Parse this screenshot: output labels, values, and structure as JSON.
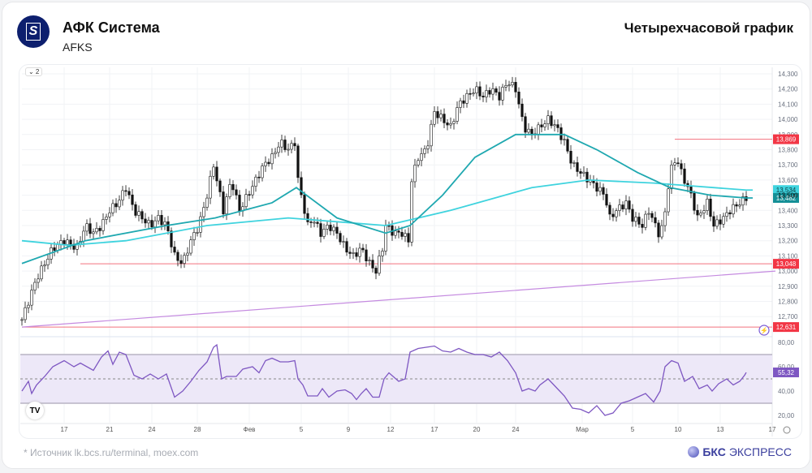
{
  "header": {
    "company": "АФК Система",
    "ticker": "AFKS",
    "chart_title": "Четырехчасовой график"
  },
  "controls": {
    "collapse_label": "⌄ 2",
    "tv_logo": "TV"
  },
  "footer": {
    "source": "*  Источник lk.bcs.ru/terminal, moex.com",
    "brand_prefix": "БКС",
    "brand_suffix": "ЭКСПРЕСС"
  },
  "chart_data": [
    {
      "type": "candlestick",
      "title": "AFKS 4H",
      "x_unit": "4h bar index",
      "ylim": [
        12600,
        14300
      ],
      "y_ticks": [
        "14,300",
        "14,200",
        "14,100",
        "14,000",
        "13,900",
        "13,800",
        "13,700",
        "13,600",
        "13,500",
        "13,400",
        "13,300",
        "13,200",
        "13,100",
        "13,000",
        "12,900",
        "12,800",
        "12,700"
      ],
      "y_tick_values": [
        14300,
        14200,
        14100,
        14000,
        13900,
        13800,
        13700,
        13600,
        13500,
        13400,
        13300,
        13200,
        13100,
        13000,
        12900,
        12800,
        12700
      ],
      "x_ticks": [
        {
          "t": 13,
          "label": "17"
        },
        {
          "t": 27,
          "label": "21"
        },
        {
          "t": 40,
          "label": "24"
        },
        {
          "t": 54,
          "label": "28"
        },
        {
          "t": 70,
          "label": "Фев"
        },
        {
          "t": 86,
          "label": "5"
        },
        {
          "t": 100.5,
          "label": "9"
        },
        {
          "t": 113.5,
          "label": "12"
        },
        {
          "t": 127,
          "label": "17"
        },
        {
          "t": 140,
          "label": "20"
        },
        {
          "t": 152,
          "label": "24"
        },
        {
          "t": 172.5,
          "label": "Мар"
        },
        {
          "t": 188,
          "label": "5"
        },
        {
          "t": 202,
          "label": "10"
        },
        {
          "t": 215,
          "label": "13"
        },
        {
          "t": 231,
          "label": "17"
        }
      ],
      "close_path": [
        [
          0,
          12680
        ],
        [
          2,
          12800
        ],
        [
          4.5,
          12950
        ],
        [
          7,
          13050
        ],
        [
          9.5,
          13150
        ],
        [
          13,
          13200
        ],
        [
          17,
          13150
        ],
        [
          19.5,
          13300
        ],
        [
          22,
          13250
        ],
        [
          24.5,
          13300
        ],
        [
          27,
          13400
        ],
        [
          29.5,
          13450
        ],
        [
          32,
          13550
        ],
        [
          34.5,
          13400
        ],
        [
          37,
          13350
        ],
        [
          39.5,
          13300
        ],
        [
          42,
          13350
        ],
        [
          44.5,
          13300
        ],
        [
          47,
          13100
        ],
        [
          49.5,
          13050
        ],
        [
          52,
          13200
        ],
        [
          54.5,
          13300
        ],
        [
          57,
          13500
        ],
        [
          59,
          13700
        ],
        [
          61,
          13500
        ],
        [
          62,
          13400
        ],
        [
          64.5,
          13600
        ],
        [
          67,
          13400
        ],
        [
          69.5,
          13500
        ],
        [
          72,
          13600
        ],
        [
          74.5,
          13700
        ],
        [
          77,
          13750
        ],
        [
          79.5,
          13850
        ],
        [
          82,
          13800
        ],
        [
          84,
          13850
        ],
        [
          85,
          13600
        ],
        [
          86.5,
          13450
        ],
        [
          88,
          13300
        ],
        [
          89.5,
          13350
        ],
        [
          92,
          13250
        ],
        [
          94.5,
          13300
        ],
        [
          97,
          13250
        ],
        [
          99.5,
          13150
        ],
        [
          102,
          13100
        ],
        [
          104.5,
          13150
        ],
        [
          107,
          13050
        ],
        [
          109,
          13000
        ],
        [
          111,
          13150
        ],
        [
          112,
          13300
        ],
        [
          114.5,
          13250
        ],
        [
          117,
          13250
        ],
        [
          119,
          13200
        ],
        [
          120,
          13600
        ],
        [
          122,
          13750
        ],
        [
          124.5,
          13800
        ],
        [
          127,
          14050
        ],
        [
          129.5,
          14000
        ],
        [
          132,
          13950
        ],
        [
          134.5,
          14100
        ],
        [
          137,
          14150
        ],
        [
          139.5,
          14200
        ],
        [
          142,
          14150
        ],
        [
          144.5,
          14200
        ],
        [
          147,
          14150
        ],
        [
          149.5,
          14250
        ],
        [
          152,
          14200
        ],
        [
          154.5,
          13950
        ],
        [
          157,
          13900
        ],
        [
          159.5,
          13950
        ],
        [
          162,
          14000
        ],
        [
          164.5,
          13950
        ],
        [
          167,
          13850
        ],
        [
          169.5,
          13700
        ],
        [
          172,
          13650
        ],
        [
          174.5,
          13600
        ],
        [
          177,
          13550
        ],
        [
          179.5,
          13500
        ],
        [
          181,
          13350
        ],
        [
          183,
          13400
        ],
        [
          186,
          13450
        ],
        [
          188,
          13350
        ],
        [
          191,
          13300
        ],
        [
          193,
          13400
        ],
        [
          196,
          13250
        ],
        [
          197.5,
          13300
        ],
        [
          199.5,
          13650
        ],
        [
          201.5,
          13750
        ],
        [
          203,
          13650
        ],
        [
          206,
          13500
        ],
        [
          208,
          13350
        ],
        [
          211,
          13450
        ],
        [
          213,
          13300
        ],
        [
          216,
          13350
        ],
        [
          218,
          13400
        ],
        [
          221,
          13450
        ],
        [
          223,
          13482
        ]
      ],
      "ma_short": {
        "color": "#1fa8b0",
        "label": "13,482",
        "points": [
          [
            0,
            13050
          ],
          [
            19.5,
            13200
          ],
          [
            44.5,
            13300
          ],
          [
            59.5,
            13350
          ],
          [
            77,
            13450
          ],
          [
            84.5,
            13550
          ],
          [
            97,
            13350
          ],
          [
            112,
            13250
          ],
          [
            119.5,
            13300
          ],
          [
            129.5,
            13500
          ],
          [
            139.5,
            13750
          ],
          [
            152,
            13900
          ],
          [
            167,
            13900
          ],
          [
            177,
            13800
          ],
          [
            189.5,
            13650
          ],
          [
            199.5,
            13550
          ],
          [
            212,
            13500
          ],
          [
            223,
            13482
          ],
          [
            225,
            13482
          ]
        ]
      },
      "ma_long": {
        "color": "#3fd3de",
        "label": "13,534",
        "points": [
          [
            0,
            13200
          ],
          [
            14.5,
            13170
          ],
          [
            32,
            13200
          ],
          [
            57,
            13300
          ],
          [
            82,
            13350
          ],
          [
            112,
            13300
          ],
          [
            132,
            13400
          ],
          [
            157,
            13550
          ],
          [
            174.5,
            13600
          ],
          [
            194.5,
            13580
          ],
          [
            223,
            13534
          ],
          [
            225,
            13534
          ]
        ]
      },
      "trendline": {
        "color": "#c58be0",
        "from": [
          0,
          12631
        ],
        "to": [
          232,
          13000
        ]
      },
      "levels": [
        {
          "value": 13869,
          "label": "13,869",
          "from": 201
        },
        {
          "value": 13048,
          "label": "13,048",
          "from": 18
        },
        {
          "value": 12631,
          "label": "12,631",
          "from": 0
        }
      ],
      "current_price_label": "13,500"
    },
    {
      "type": "line",
      "title": "RSI",
      "ylim": [
        14,
        86
      ],
      "y_ticks": [
        "80,00",
        "60,00",
        "40,00",
        "20,00"
      ],
      "y_tick_values": [
        80,
        60,
        40,
        20
      ],
      "bands": {
        "upper": 70,
        "middle": 50,
        "lower": 30
      },
      "last_value_label": "55,32",
      "series": [
        {
          "name": "RSI",
          "color": "#7e57c2",
          "points": [
            [
              0,
              40
            ],
            [
              2,
              48
            ],
            [
              3,
              38
            ],
            [
              4.5,
              45
            ],
            [
              7,
              52
            ],
            [
              9.5,
              60
            ],
            [
              13,
              65
            ],
            [
              16,
              60
            ],
            [
              18,
              63
            ],
            [
              22,
              57
            ],
            [
              24.5,
              68
            ],
            [
              26.5,
              73
            ],
            [
              28,
              62
            ],
            [
              30,
              72
            ],
            [
              32,
              70
            ],
            [
              34.5,
              53
            ],
            [
              37,
              50
            ],
            [
              39.5,
              54
            ],
            [
              42,
              50
            ],
            [
              44.5,
              54
            ],
            [
              47,
              35
            ],
            [
              49.5,
              40
            ],
            [
              52,
              48
            ],
            [
              54.5,
              57
            ],
            [
              57,
              64
            ],
            [
              59,
              76
            ],
            [
              60,
              78
            ],
            [
              61.5,
              50
            ],
            [
              63,
              52
            ],
            [
              66,
              52
            ],
            [
              68,
              58
            ],
            [
              71,
              60
            ],
            [
              73,
              55
            ],
            [
              75,
              65
            ],
            [
              77,
              67
            ],
            [
              79.5,
              64
            ],
            [
              82,
              64
            ],
            [
              84,
              65
            ],
            [
              85,
              50
            ],
            [
              86.5,
              45
            ],
            [
              88,
              36
            ],
            [
              91,
              36
            ],
            [
              92.5,
              42
            ],
            [
              94.5,
              35
            ],
            [
              97,
              40
            ],
            [
              99.5,
              41
            ],
            [
              101.5,
              38
            ],
            [
              103,
              33
            ],
            [
              104.5,
              38
            ],
            [
              106,
              42
            ],
            [
              108,
              35
            ],
            [
              110,
              35
            ],
            [
              111.5,
              50
            ],
            [
              113,
              55
            ],
            [
              116,
              48
            ],
            [
              118,
              50
            ],
            [
              119.5,
              72
            ],
            [
              122,
              75
            ],
            [
              124.5,
              76
            ],
            [
              127,
              77
            ],
            [
              129.5,
              73
            ],
            [
              132,
              72
            ],
            [
              134.5,
              75
            ],
            [
              137,
              72
            ],
            [
              139.5,
              70
            ],
            [
              142,
              70
            ],
            [
              144.5,
              68
            ],
            [
              147,
              72
            ],
            [
              149.5,
              65
            ],
            [
              152,
              55
            ],
            [
              154,
              40
            ],
            [
              156,
              42
            ],
            [
              158,
              40
            ],
            [
              159.5,
              45
            ],
            [
              162,
              50
            ],
            [
              164.5,
              43
            ],
            [
              167,
              36
            ],
            [
              169.5,
              26
            ],
            [
              172,
              25
            ],
            [
              174.5,
              22
            ],
            [
              177,
              28
            ],
            [
              179.5,
              20
            ],
            [
              182,
              22
            ],
            [
              184.5,
              30
            ],
            [
              187,
              32
            ],
            [
              189.5,
              35
            ],
            [
              192,
              38
            ],
            [
              194.5,
              31
            ],
            [
              196.5,
              40
            ],
            [
              198,
              60
            ],
            [
              200,
              65
            ],
            [
              202,
              63
            ],
            [
              204,
              48
            ],
            [
              206.5,
              52
            ],
            [
              208.5,
              42
            ],
            [
              211,
              45
            ],
            [
              212.5,
              40
            ],
            [
              214.5,
              46
            ],
            [
              217,
              50
            ],
            [
              219,
              45
            ],
            [
              221,
              48
            ],
            [
              222.5,
              53
            ],
            [
              223,
              55.32
            ]
          ]
        }
      ]
    }
  ]
}
